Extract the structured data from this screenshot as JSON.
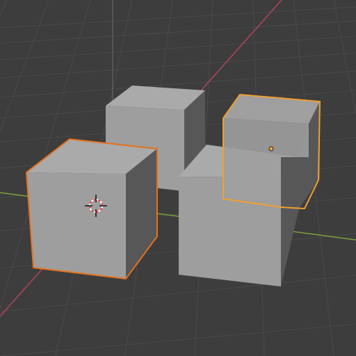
{
  "viewport": {
    "background": "#3d3d3d",
    "grid_color": "#4a4a4a",
    "x_axis_color": "#b0455a",
    "y_axis_color": "#7da23a",
    "z_axis_color": "#5d5d5d"
  },
  "objects": [
    {
      "name": "cube-back",
      "selected": false,
      "active": false
    },
    {
      "name": "cube-left",
      "selected": true,
      "active": false,
      "outline_color": "#e6701c"
    },
    {
      "name": "cube-front-right",
      "selected": false,
      "active": false
    },
    {
      "name": "cube-right",
      "selected": true,
      "active": true,
      "outline_color": "#f0a030"
    }
  ],
  "cube_face_colors": {
    "front": "#9e9e9e",
    "side": "#575757",
    "top": "#aaaaaa"
  },
  "cursor": {
    "icon": "3d-cursor-icon",
    "colors": [
      "#ff3333",
      "#ffffff"
    ]
  },
  "origin_marker": {
    "icon": "object-origin-icon",
    "color": "#f0a030"
  }
}
